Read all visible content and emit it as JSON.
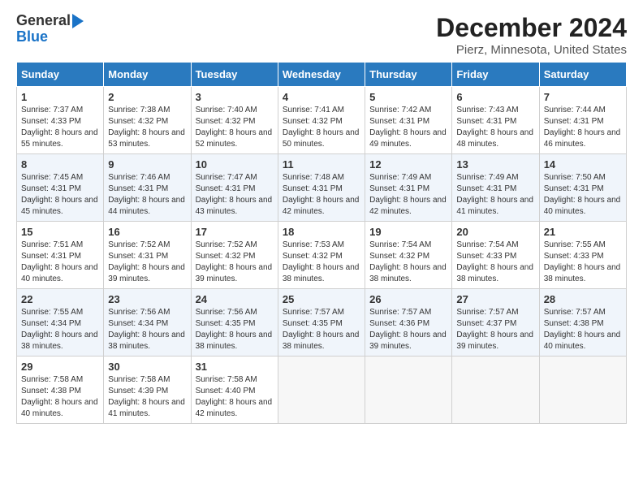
{
  "header": {
    "logo_general": "General",
    "logo_blue": "Blue",
    "title": "December 2024",
    "subtitle": "Pierz, Minnesota, United States"
  },
  "days": [
    "Sunday",
    "Monday",
    "Tuesday",
    "Wednesday",
    "Thursday",
    "Friday",
    "Saturday"
  ],
  "weeks": [
    [
      {
        "day": "1",
        "sunrise": "Sunrise: 7:37 AM",
        "sunset": "Sunset: 4:33 PM",
        "daylight": "Daylight: 8 hours and 55 minutes."
      },
      {
        "day": "2",
        "sunrise": "Sunrise: 7:38 AM",
        "sunset": "Sunset: 4:32 PM",
        "daylight": "Daylight: 8 hours and 53 minutes."
      },
      {
        "day": "3",
        "sunrise": "Sunrise: 7:40 AM",
        "sunset": "Sunset: 4:32 PM",
        "daylight": "Daylight: 8 hours and 52 minutes."
      },
      {
        "day": "4",
        "sunrise": "Sunrise: 7:41 AM",
        "sunset": "Sunset: 4:32 PM",
        "daylight": "Daylight: 8 hours and 50 minutes."
      },
      {
        "day": "5",
        "sunrise": "Sunrise: 7:42 AM",
        "sunset": "Sunset: 4:31 PM",
        "daylight": "Daylight: 8 hours and 49 minutes."
      },
      {
        "day": "6",
        "sunrise": "Sunrise: 7:43 AM",
        "sunset": "Sunset: 4:31 PM",
        "daylight": "Daylight: 8 hours and 48 minutes."
      },
      {
        "day": "7",
        "sunrise": "Sunrise: 7:44 AM",
        "sunset": "Sunset: 4:31 PM",
        "daylight": "Daylight: 8 hours and 46 minutes."
      }
    ],
    [
      {
        "day": "8",
        "sunrise": "Sunrise: 7:45 AM",
        "sunset": "Sunset: 4:31 PM",
        "daylight": "Daylight: 8 hours and 45 minutes."
      },
      {
        "day": "9",
        "sunrise": "Sunrise: 7:46 AM",
        "sunset": "Sunset: 4:31 PM",
        "daylight": "Daylight: 8 hours and 44 minutes."
      },
      {
        "day": "10",
        "sunrise": "Sunrise: 7:47 AM",
        "sunset": "Sunset: 4:31 PM",
        "daylight": "Daylight: 8 hours and 43 minutes."
      },
      {
        "day": "11",
        "sunrise": "Sunrise: 7:48 AM",
        "sunset": "Sunset: 4:31 PM",
        "daylight": "Daylight: 8 hours and 42 minutes."
      },
      {
        "day": "12",
        "sunrise": "Sunrise: 7:49 AM",
        "sunset": "Sunset: 4:31 PM",
        "daylight": "Daylight: 8 hours and 42 minutes."
      },
      {
        "day": "13",
        "sunrise": "Sunrise: 7:49 AM",
        "sunset": "Sunset: 4:31 PM",
        "daylight": "Daylight: 8 hours and 41 minutes."
      },
      {
        "day": "14",
        "sunrise": "Sunrise: 7:50 AM",
        "sunset": "Sunset: 4:31 PM",
        "daylight": "Daylight: 8 hours and 40 minutes."
      }
    ],
    [
      {
        "day": "15",
        "sunrise": "Sunrise: 7:51 AM",
        "sunset": "Sunset: 4:31 PM",
        "daylight": "Daylight: 8 hours and 40 minutes."
      },
      {
        "day": "16",
        "sunrise": "Sunrise: 7:52 AM",
        "sunset": "Sunset: 4:31 PM",
        "daylight": "Daylight: 8 hours and 39 minutes."
      },
      {
        "day": "17",
        "sunrise": "Sunrise: 7:52 AM",
        "sunset": "Sunset: 4:32 PM",
        "daylight": "Daylight: 8 hours and 39 minutes."
      },
      {
        "day": "18",
        "sunrise": "Sunrise: 7:53 AM",
        "sunset": "Sunset: 4:32 PM",
        "daylight": "Daylight: 8 hours and 38 minutes."
      },
      {
        "day": "19",
        "sunrise": "Sunrise: 7:54 AM",
        "sunset": "Sunset: 4:32 PM",
        "daylight": "Daylight: 8 hours and 38 minutes."
      },
      {
        "day": "20",
        "sunrise": "Sunrise: 7:54 AM",
        "sunset": "Sunset: 4:33 PM",
        "daylight": "Daylight: 8 hours and 38 minutes."
      },
      {
        "day": "21",
        "sunrise": "Sunrise: 7:55 AM",
        "sunset": "Sunset: 4:33 PM",
        "daylight": "Daylight: 8 hours and 38 minutes."
      }
    ],
    [
      {
        "day": "22",
        "sunrise": "Sunrise: 7:55 AM",
        "sunset": "Sunset: 4:34 PM",
        "daylight": "Daylight: 8 hours and 38 minutes."
      },
      {
        "day": "23",
        "sunrise": "Sunrise: 7:56 AM",
        "sunset": "Sunset: 4:34 PM",
        "daylight": "Daylight: 8 hours and 38 minutes."
      },
      {
        "day": "24",
        "sunrise": "Sunrise: 7:56 AM",
        "sunset": "Sunset: 4:35 PM",
        "daylight": "Daylight: 8 hours and 38 minutes."
      },
      {
        "day": "25",
        "sunrise": "Sunrise: 7:57 AM",
        "sunset": "Sunset: 4:35 PM",
        "daylight": "Daylight: 8 hours and 38 minutes."
      },
      {
        "day": "26",
        "sunrise": "Sunrise: 7:57 AM",
        "sunset": "Sunset: 4:36 PM",
        "daylight": "Daylight: 8 hours and 39 minutes."
      },
      {
        "day": "27",
        "sunrise": "Sunrise: 7:57 AM",
        "sunset": "Sunset: 4:37 PM",
        "daylight": "Daylight: 8 hours and 39 minutes."
      },
      {
        "day": "28",
        "sunrise": "Sunrise: 7:57 AM",
        "sunset": "Sunset: 4:38 PM",
        "daylight": "Daylight: 8 hours and 40 minutes."
      }
    ],
    [
      {
        "day": "29",
        "sunrise": "Sunrise: 7:58 AM",
        "sunset": "Sunset: 4:38 PM",
        "daylight": "Daylight: 8 hours and 40 minutes."
      },
      {
        "day": "30",
        "sunrise": "Sunrise: 7:58 AM",
        "sunset": "Sunset: 4:39 PM",
        "daylight": "Daylight: 8 hours and 41 minutes."
      },
      {
        "day": "31",
        "sunrise": "Sunrise: 7:58 AM",
        "sunset": "Sunset: 4:40 PM",
        "daylight": "Daylight: 8 hours and 42 minutes."
      },
      null,
      null,
      null,
      null
    ]
  ]
}
